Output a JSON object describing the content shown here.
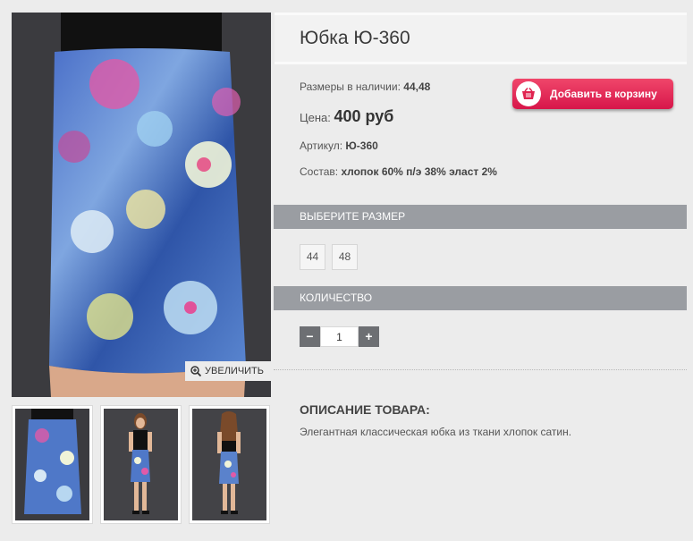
{
  "product": {
    "title": "Юбка Ю-360",
    "sizes_label": "Размеры в наличии:",
    "sizes_value": "44,48",
    "price_label": "Цена:",
    "price_value": "400 руб",
    "article_label": "Артикул:",
    "article_value": "Ю-360",
    "composition_label": "Состав:",
    "composition_value": "хлопок 60% п/э 38% эласт 2%"
  },
  "cart_button": {
    "label": "Добавить в корзину",
    "icon": "basket-icon",
    "color": "#e0234f"
  },
  "zoom": {
    "label": "УВЕЛИЧИТЬ",
    "icon": "magnifier-plus-icon"
  },
  "size_section": {
    "title": "ВЫБЕРИТЕ РАЗМЕР",
    "options": [
      "44",
      "48"
    ]
  },
  "quantity_section": {
    "title": "КОЛИЧЕСТВО",
    "value": "1",
    "minus": "−",
    "plus": "+"
  },
  "description": {
    "title": "ОПИСАНИЕ ТОВАРА:",
    "text": "Элегантная классическая юбка из ткани хлопок сатин."
  },
  "colors": {
    "section_bar": "#9a9da2",
    "cart_button": "#e0234f",
    "background": "#ececec"
  }
}
